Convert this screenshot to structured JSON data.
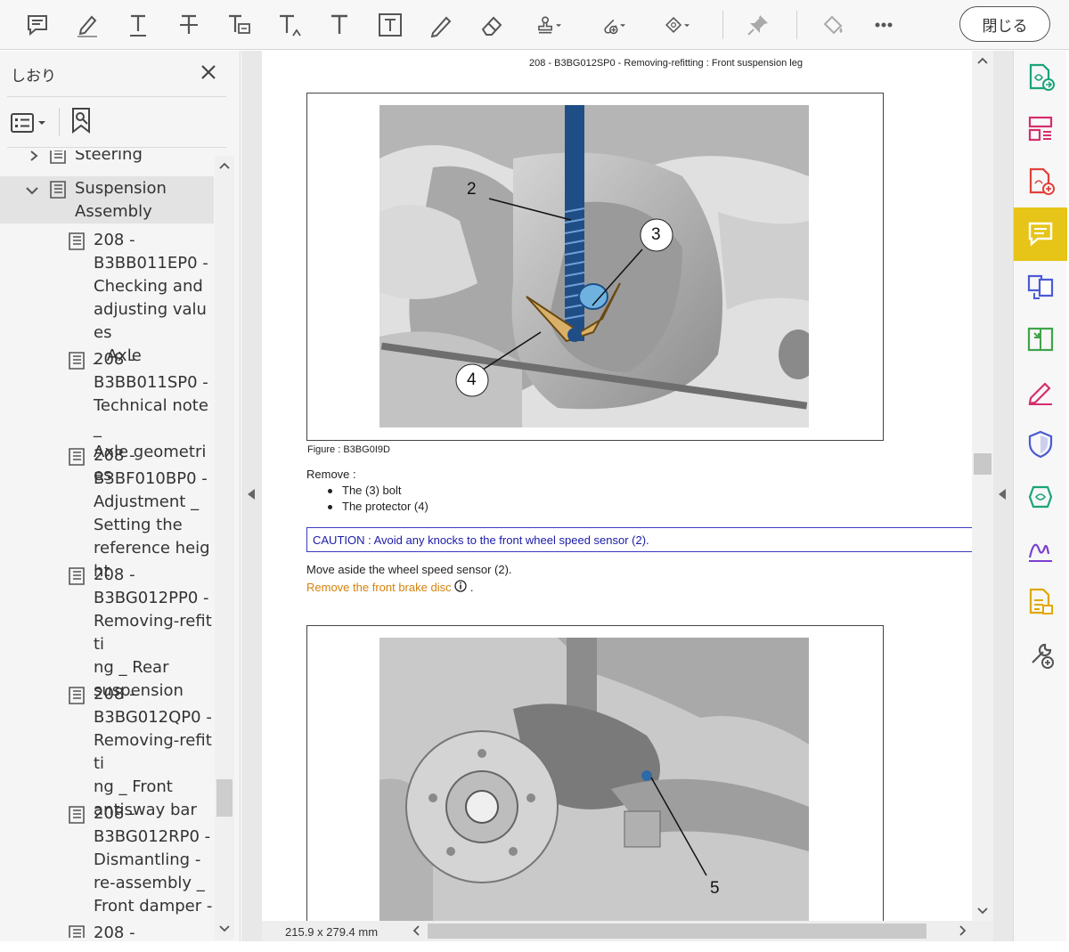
{
  "toolbar": {
    "close_label": "閉じる",
    "icons": [
      "comment-icon",
      "highlight-icon",
      "underline-text-icon",
      "strikethrough-icon",
      "replace-text-icon",
      "insert-text-icon",
      "add-text-icon",
      "text-box-icon",
      "pencil-icon",
      "eraser-icon",
      "stamp-icon",
      "attach-file-icon",
      "shapes-icon",
      "pin-icon",
      "fill-color-icon",
      "more-icon"
    ]
  },
  "bookmarks_panel": {
    "title": "しおり",
    "items": [
      {
        "label": "Steering",
        "level": 1,
        "expanded": false
      },
      {
        "label": "Suspension\nAssembly",
        "level": 1,
        "expanded": true,
        "selected": true
      },
      {
        "label": "208 -\nB3BB011EP0 -\nChecking and\nadjusting values\n_ Axle",
        "level": 2
      },
      {
        "label": "208 -\nB3BB011SP0 -\nTechnical note _\nAxle geometries",
        "level": 2
      },
      {
        "label": "208 -\nB3BF010BP0 -\nAdjustment _\nSetting the\nreference height",
        "level": 2
      },
      {
        "label": "208 -\nB3BG012PP0 -\nRemoving-refitti\nng _ Rear\nsuspension",
        "level": 2
      },
      {
        "label": "208 -\nB3BG012QP0 -\nRemoving-refitti\nng _ Front\nantisway bar",
        "level": 2
      },
      {
        "label": "208 -\nB3BG012RP0 -\nDismantling -\nre-assembly _\nFront damper -",
        "level": 2
      },
      {
        "label": "208 -",
        "level": 2
      }
    ]
  },
  "document": {
    "header": "208 - B3BG012SP0 - Removing-refitting : Front suspension leg",
    "figure1_callouts": [
      "2",
      "3",
      "4"
    ],
    "figure1_caption": "Figure : B3BG0I9D",
    "remove_label": "Remove :",
    "remove_items": [
      "The (3) bolt",
      "The protector (4)"
    ],
    "caution": "CAUTION : Avoid any knocks to the front wheel speed sensor (2).",
    "move_aside": "Move aside the wheel speed sensor (2).",
    "remove_brake_link": "Remove the front brake disc",
    "remove_brake_suffix": ".",
    "figure2_callouts": [
      "5"
    ],
    "page_size": "215.9 x 279.4 mm"
  },
  "right_rail": {
    "tools": [
      "export-pdf-icon",
      "organize-pages-icon",
      "create-pdf-icon",
      "comment-tool-icon",
      "combine-files-icon",
      "compress-icon",
      "fill-sign-icon",
      "protect-icon",
      "send-for-review-icon",
      "request-signature-icon",
      "more-tools-doc-icon",
      "add-tools-icon"
    ],
    "active_tool": "comment-tool-icon"
  }
}
